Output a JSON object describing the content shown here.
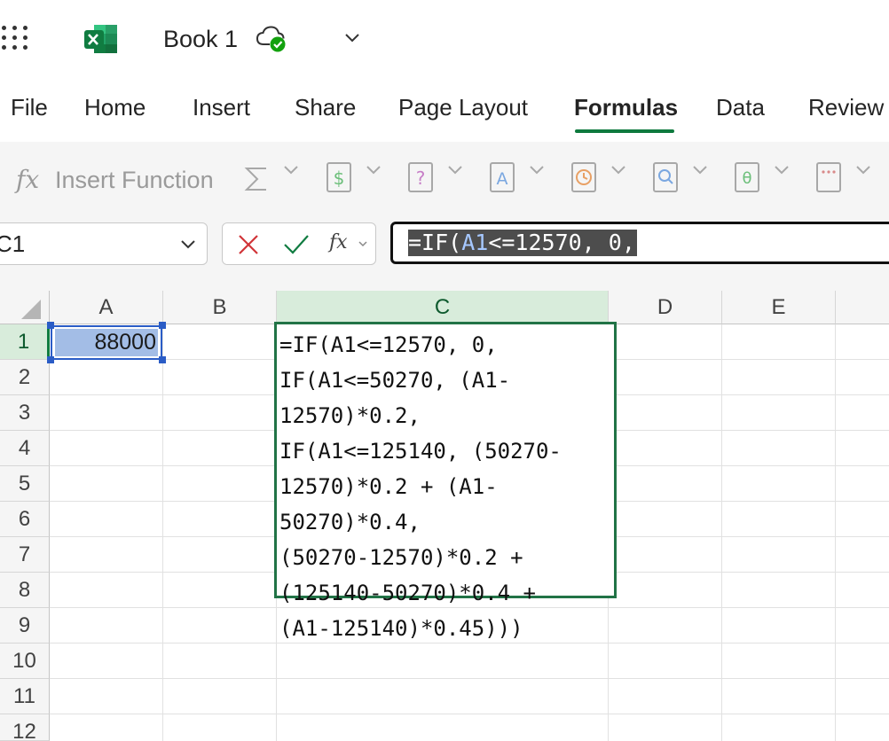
{
  "titlebar": {
    "app_icon": "excel-logo-icon",
    "document_title": "Book 1",
    "cloud_status_icon": "cloud-saved-icon"
  },
  "ribbon": {
    "tabs": [
      {
        "label": "File"
      },
      {
        "label": "Home"
      },
      {
        "label": "Insert"
      },
      {
        "label": "Share"
      },
      {
        "label": "Page Layout"
      },
      {
        "label": "Formulas",
        "active": true
      },
      {
        "label": "Data"
      },
      {
        "label": "Review"
      }
    ],
    "accent_color": "#0e7a3e"
  },
  "toolbar": {
    "fx_glyph": "fx",
    "insert_function_label": "Insert Function",
    "buttons": [
      {
        "icon": "autosum-icon"
      },
      {
        "icon": "financial-icon"
      },
      {
        "icon": "logical-icon"
      },
      {
        "icon": "text-icon"
      },
      {
        "icon": "date-time-icon"
      },
      {
        "icon": "lookup-icon"
      },
      {
        "icon": "math-trig-icon"
      },
      {
        "icon": "more-functions-icon"
      }
    ]
  },
  "formula_bar": {
    "name_box_value": "C1",
    "fx_glyph": "fx",
    "formula_prefix": "=IF(",
    "formula_ref": "A1",
    "formula_suffix": "<=12570, 0,"
  },
  "grid": {
    "columns": [
      "A",
      "B",
      "C",
      "D",
      "E",
      ""
    ],
    "selected_column": "C",
    "rows": [
      "1",
      "2",
      "3",
      "4",
      "5",
      "6",
      "7",
      "8",
      "9",
      "10",
      "11",
      "12"
    ],
    "selected_row": "1",
    "cells": {
      "A1": "88000",
      "C1_lines": [
        "=IF(A1<=12570, 0,",
        "IF(A1<=50270, (A1-",
        "12570)*0.2,",
        "IF(A1<=125140, (50270-",
        "12570)*0.2 + (A1-",
        "50270)*0.4,",
        "(50270-12570)*0.2 +",
        "(125140-50270)*0.4 +",
        "(A1-125140)*0.45)))"
      ]
    },
    "colors": {
      "selection_green": "#107c41",
      "reference_blue": "#2a5cc6"
    }
  }
}
